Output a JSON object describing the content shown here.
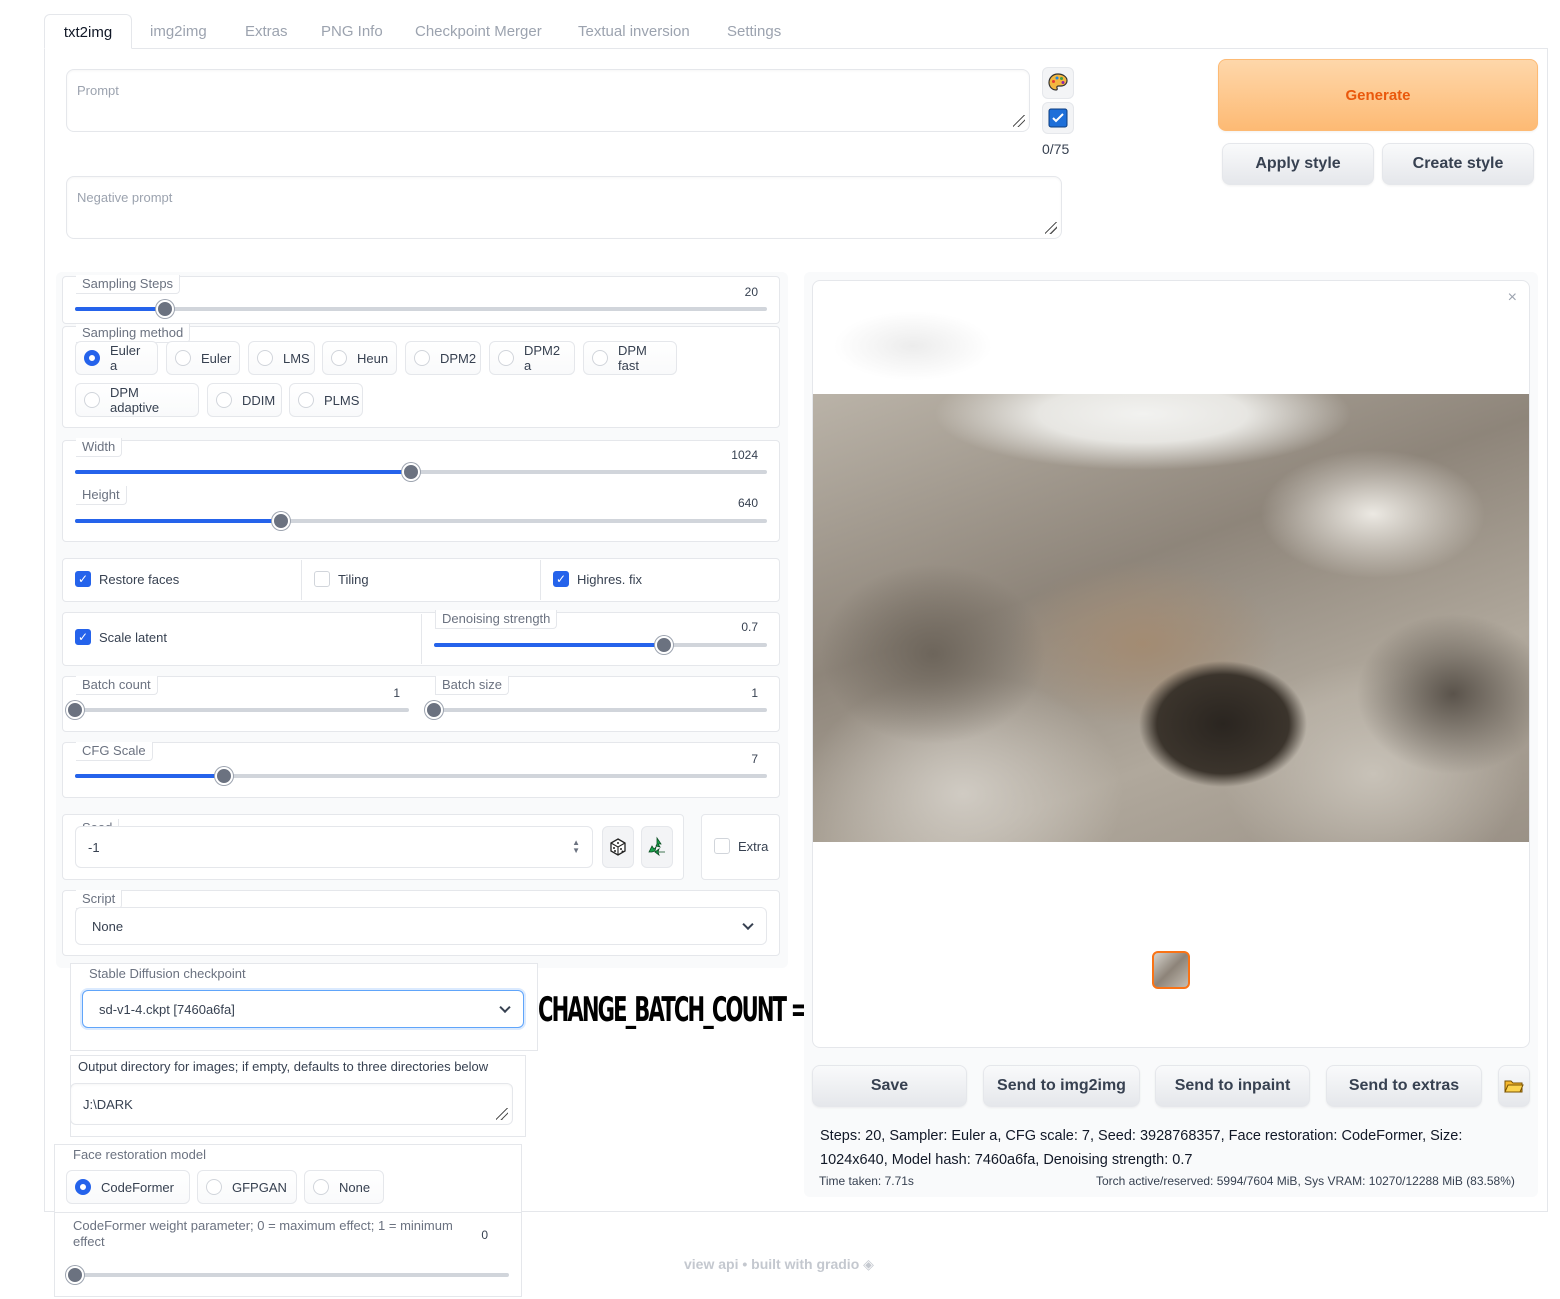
{
  "tabs": [
    "txt2img",
    "img2img",
    "Extras",
    "PNG Info",
    "Checkpoint Merger",
    "Textual inversion",
    "Settings"
  ],
  "prompt": {
    "placeholder": "Prompt",
    "token_count": "0/75"
  },
  "negative_prompt": {
    "placeholder": "Negative prompt"
  },
  "buttons": {
    "generate": "Generate",
    "apply_style": "Apply style",
    "create_style": "Create style"
  },
  "sampling_steps": {
    "label": "Sampling Steps",
    "value": "20",
    "fraction": 0.13
  },
  "sampling_method": {
    "label": "Sampling method",
    "options": [
      "Euler a",
      "Euler",
      "LMS",
      "Heun",
      "DPM2",
      "DPM2 a",
      "DPM fast",
      "DPM adaptive",
      "DDIM",
      "PLMS"
    ],
    "selected": "Euler a"
  },
  "width": {
    "label": "Width",
    "value": "1024",
    "fraction": 0.485
  },
  "height": {
    "label": "Height",
    "value": "640",
    "fraction": 0.298
  },
  "checks": {
    "restore_faces": {
      "label": "Restore faces",
      "checked": true
    },
    "tiling": {
      "label": "Tiling",
      "checked": false
    },
    "highres_fix": {
      "label": "Highres. fix",
      "checked": true
    },
    "scale_latent": {
      "label": "Scale latent",
      "checked": true
    },
    "extra": {
      "label": "Extra",
      "checked": false
    }
  },
  "denoising": {
    "label": "Denoising strength",
    "value": "0.7",
    "fraction": 0.69
  },
  "batch_count": {
    "label": "Batch count",
    "value": "1",
    "fraction": 0.0
  },
  "batch_size": {
    "label": "Batch size",
    "value": "1",
    "fraction": 0.0
  },
  "cfg_scale": {
    "label": "CFG Scale",
    "value": "7",
    "fraction": 0.216
  },
  "seed": {
    "label": "Seed",
    "value": "-1"
  },
  "script": {
    "label": "Script",
    "value": "None"
  },
  "checkpoint": {
    "label": "Stable Diffusion checkpoint",
    "value": "sd-v1-4.ckpt [7460a6fa]"
  },
  "annotation": "CHANGE_BATCH_COUNT ===",
  "output_dir": {
    "label": "Output directory for images; if empty, defaults to three directories below",
    "value": "J:\\DARK"
  },
  "face_restoration": {
    "label": "Face restoration model",
    "options": [
      "CodeFormer",
      "GFPGAN",
      "None"
    ],
    "selected": "CodeFormer"
  },
  "codeformer_weight": {
    "label": "CodeFormer weight parameter; 0 = maximum effect; 1 = minimum effect",
    "value": "0",
    "fraction": 0.0
  },
  "output_buttons": [
    "Save",
    "Send to img2img",
    "Send to inpaint",
    "Send to extras"
  ],
  "generation_info": "Steps: 20, Sampler: Euler a, CFG scale: 7, Seed: 3928768357, Face restoration: CodeFormer, Size: 1024x640, Model hash: 7460a6fa, Denoising strength: 0.7",
  "time_taken": "Time taken: 7.71s",
  "vram": "Torch active/reserved: 5994/7604 MiB, Sys VRAM: 10270/12288 MiB (83.58%)",
  "footer": {
    "api": "view api",
    "built": "built with gradio"
  },
  "colors": {
    "accent": "#2563eb",
    "generate": "#ea580c"
  }
}
